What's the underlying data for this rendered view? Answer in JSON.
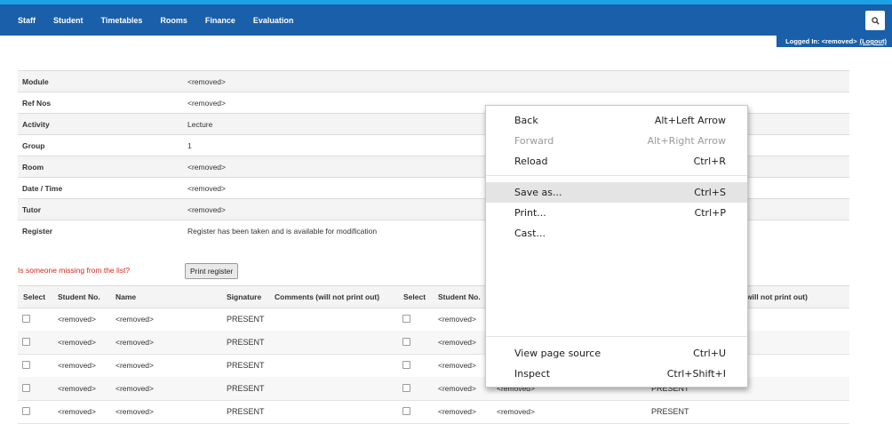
{
  "nav": {
    "items": [
      "Staff",
      "Student",
      "Timetables",
      "Rooms",
      "Finance",
      "Evaluation"
    ],
    "search_icon": "search-icon"
  },
  "login": {
    "text": "Logged In: <removed>",
    "logout": "(Logout)"
  },
  "info": {
    "rows": [
      {
        "label": "Module",
        "value": "<removed>"
      },
      {
        "label": "Ref Nos",
        "value": "<removed>"
      },
      {
        "label": "Activity",
        "value": "Lecture"
      },
      {
        "label": "Group",
        "value": "1"
      },
      {
        "label": "Room",
        "value": "<removed>"
      },
      {
        "label": "Date / Time",
        "value": "<removed>"
      },
      {
        "label": "Tutor",
        "value": "<removed>"
      },
      {
        "label": "Register",
        "value": "Register has been taken and is available for modification"
      }
    ]
  },
  "register": {
    "missing_link": "Is someone missing from the list?",
    "print_button": "Print register",
    "headers": {
      "select": "Select",
      "student_no": "Student No.",
      "name": "Name",
      "signature": "Signature",
      "comments": "Comments (will not print out)",
      "select2": "Select",
      "student_no2": "Student No.",
      "comments2_partial": "will not print out)"
    },
    "rows": [
      {
        "student_no": "<removed>",
        "name": "<removed>",
        "signature": "PRESENT",
        "student_no2": "<removed>"
      },
      {
        "student_no": "<removed>",
        "name": "<removed>",
        "signature": "PRESENT",
        "student_no2": "<removed>"
      },
      {
        "student_no": "<removed>",
        "name": "<removed>",
        "signature": "PRESENT",
        "student_no2": "<removed>"
      },
      {
        "student_no": "<removed>",
        "name": "<removed>",
        "signature": "PRESENT",
        "student_no2": "<removed>",
        "name2": "<removed>",
        "signature2": "PRESENT"
      },
      {
        "student_no": "<removed>",
        "name": "<removed>",
        "signature": "PRESENT",
        "student_no2": "<removed>",
        "name2": "<removed>",
        "signature2": "PRESENT"
      }
    ]
  },
  "context_menu": {
    "items": [
      {
        "label": "Back",
        "shortcut": "Alt+Left Arrow",
        "disabled": false
      },
      {
        "label": "Forward",
        "shortcut": "Alt+Right Arrow",
        "disabled": true
      },
      {
        "label": "Reload",
        "shortcut": "Ctrl+R",
        "disabled": false
      },
      {
        "label": "Save as...",
        "shortcut": "Ctrl+S",
        "disabled": false,
        "hovered": true
      },
      {
        "label": "Print...",
        "shortcut": "Ctrl+P",
        "disabled": false
      },
      {
        "label": "Cast...",
        "shortcut": "",
        "disabled": false
      },
      {
        "label": "View page source",
        "shortcut": "Ctrl+U",
        "disabled": false
      },
      {
        "label": "Inspect",
        "shortcut": "Ctrl+Shift+I",
        "disabled": false
      }
    ]
  }
}
